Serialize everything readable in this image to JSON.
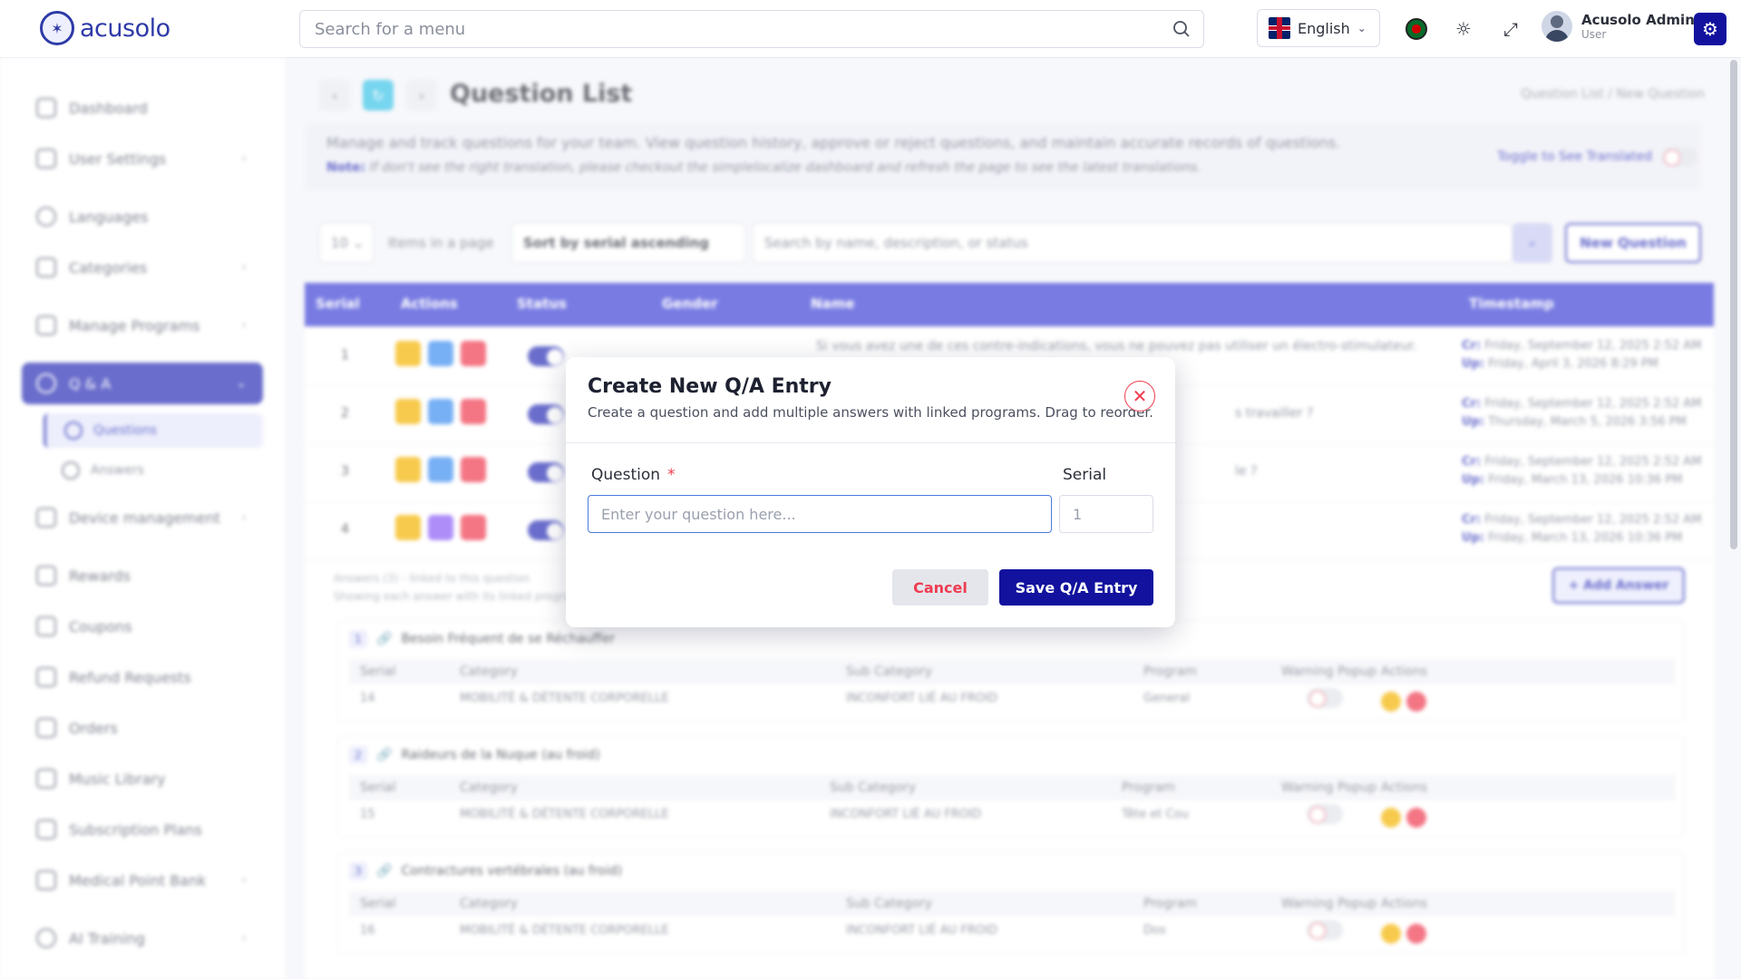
{
  "header": {
    "logo_text": "acusolo",
    "search_placeholder": "Search for a menu",
    "language": "English",
    "user_name": "Acusolo Admin",
    "user_role": "User",
    "brand_color": "#12129e"
  },
  "sidebar": {
    "items": [
      {
        "label": "Dashboard",
        "icon": "grid-icon"
      },
      {
        "label": "User Settings",
        "icon": "user-gear-icon"
      },
      {
        "label": "Languages",
        "icon": "globe-icon"
      },
      {
        "label": "Categories",
        "icon": "list-icon"
      },
      {
        "label": "Manage Programs",
        "icon": "boxes-icon"
      },
      {
        "label": "Q & A",
        "icon": "question-icon"
      },
      {
        "label": "Device management",
        "icon": "device-icon"
      },
      {
        "label": "Rewards",
        "icon": "trophy-icon"
      },
      {
        "label": "Coupons",
        "icon": "ticket-icon"
      },
      {
        "label": "Refund Requests",
        "icon": "refund-icon"
      },
      {
        "label": "Orders",
        "icon": "orders-icon"
      },
      {
        "label": "Music Library",
        "icon": "music-icon"
      },
      {
        "label": "Subscription Plans",
        "icon": "card-icon"
      },
      {
        "label": "Medical Point Bank",
        "icon": "heart-icon"
      },
      {
        "label": "AI Training",
        "icon": "ai-icon"
      }
    ],
    "sub_items": [
      {
        "label": "Questions"
      },
      {
        "label": "Answers"
      }
    ]
  },
  "page": {
    "title": "Question List",
    "breadcrumb": "Question List  /  New Question",
    "description": "Manage and track questions for your team. View question history, approve or reject questions, and maintain accurate records of questions.",
    "note_label": "Note:",
    "note_text": "If don't see the right translation, please checkout the simplelocalize dashboard and refresh the page to see the latest translations.",
    "toggle_translated": "Toggle to See Translated"
  },
  "controls": {
    "page_size": "10",
    "items_in_page": "Items in a page",
    "sort": "Sort by serial ascending",
    "search_placeholder": "Search by name, description, or status",
    "new_question": "New Question"
  },
  "table": {
    "headers": [
      "Serial",
      "Actions",
      "Status",
      "Gender",
      "Name",
      "Timestamp"
    ],
    "rows": [
      {
        "serial": "1",
        "name": "Si vous avez une de ces contre-indications, vous ne pouvez pas utiliser un électro-stimulateur.",
        "cr": "Friday, September 12, 2025 2:52 AM",
        "up": "Friday, April 3, 2026 8:29 PM"
      },
      {
        "serial": "2",
        "name": "s travailler ?",
        "cr": "Friday, September 12, 2025 2:52 AM",
        "up": "Thursday, March 5, 2026 3:56 PM"
      },
      {
        "serial": "3",
        "name": "le ?",
        "cr": "Friday, September 12, 2025 2:52 AM",
        "up": "Friday, March 13, 2026 10:36 PM"
      },
      {
        "serial": "4",
        "name": "",
        "cr": "Friday, September 12, 2025 2:52 AM",
        "up": "Friday, March 13, 2026 10:36 PM"
      }
    ],
    "cr_label": "Cr:",
    "up_label": "Up:"
  },
  "answers": {
    "note_line1": "Answers (3) - linked to this question",
    "note_line2": "Showing each answer with its linked programs",
    "add_answer": "+ Add Answer",
    "columns": [
      "Serial",
      "Category",
      "Sub Category",
      "Program",
      "Warning Popup",
      "Actions"
    ],
    "cards": [
      {
        "n": "1",
        "title": "Besoin Fréquent de se Réchauffer",
        "serial": "14",
        "category": "MOBILITÉ & DÉTENTE CORPORELLE",
        "sub_category": "INCONFORT LIÉ AU FROID",
        "program": "General"
      },
      {
        "n": "2",
        "title": "Raideurs de la Nuque (au froid)",
        "serial": "15",
        "category": "MOBILITÉ & DÉTENTE CORPORELLE",
        "sub_category": "INCONFORT LIÉ AU FROID",
        "program": "Tête et Cou"
      },
      {
        "n": "3",
        "title": "Contractures vertébrales (au froid)",
        "serial": "16",
        "category": "MOBILITÉ & DÉTENTE CORPORELLE",
        "sub_category": "INCONFORT LIÉ AU FROID",
        "program": "Dos"
      }
    ]
  },
  "modal": {
    "title": "Create New Q/A Entry",
    "subtitle": "Create a question and add multiple answers with linked programs. Drag to reorder.",
    "question_label": "Question",
    "required_mark": "*",
    "question_placeholder": "Enter your question here...",
    "serial_label": "Serial",
    "serial_placeholder": "1",
    "cancel": "Cancel",
    "save": "Save Q/A Entry"
  }
}
